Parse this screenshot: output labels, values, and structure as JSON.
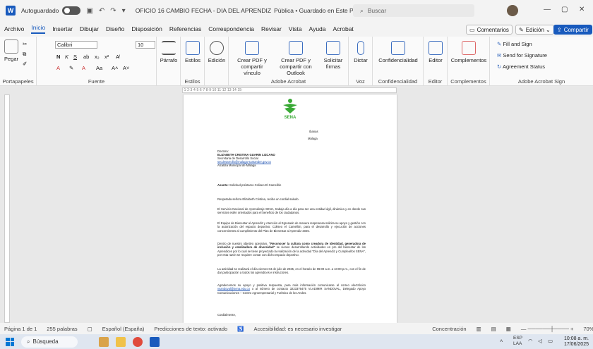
{
  "titlebar": {
    "autosave": "Autoguardado",
    "doc_title": "OFICIO 16 CAMBIO FECHA - DIA DEL APRENDIZ",
    "visibility": "Pública • Guardado en Este PC",
    "search_placeholder": "Buscar"
  },
  "tabs": [
    "Archivo",
    "Inicio",
    "Insertar",
    "Dibujar",
    "Diseño",
    "Disposición",
    "Referencias",
    "Correspondencia",
    "Revisar",
    "Vista",
    "Ayuda",
    "Acrobat"
  ],
  "ribbon_right": {
    "comments": "Comentarios",
    "editing": "Edición",
    "share": "Compartir"
  },
  "ribbon": {
    "paste": "Pegar",
    "clipboard": "Portapapeles",
    "font_name": "Calibri",
    "font_size": "10",
    "font_group": "Fuente",
    "paragraph": "Párrafo",
    "styles": "Estilos",
    "styles_group": "Estilos",
    "editing": "Edición",
    "create_pdf_link": "Crear PDF y compartir vínculo",
    "create_pdf_outlook": "Crear PDF y compartir con Outlook",
    "request_sign": "Solicitar firmas",
    "adobe_acrobat": "Adobe Acrobat",
    "dictate": "Dictar",
    "voice": "Voz",
    "confidentiality": "Confidencialidad",
    "confidentiality_group": "Confidencialidad",
    "editor": "Editor",
    "editor_group": "Editor",
    "addins": "Complementos",
    "addins_group": "Complementos",
    "fill_sign": "Fill and Sign",
    "send_signature": "Send for Signature",
    "agreement_status": "Agreement Status",
    "acrobat_sign": "Adobe Acrobat Sign"
  },
  "document": {
    "logo_text": "SENA",
    "city_header": "Ibanas",
    "place": "Málaga",
    "salutation": "Doctora:",
    "recipient_name": "ELIZABETH CRISTINA GUARIN LIZCANO",
    "recipient_role": "Secretaria de Desarrollo Social",
    "recipient_email": "secdesarrollo@malaga-santander.gov.co",
    "recipient_org": "Alcaldía Municipal de Málaga",
    "subject_label": "Asunto:",
    "subject": "Solicitud préstamo Coliseo El Camellón",
    "greeting": "Respetada señora Elizabeth Cristina, reciba un cordial saludo.",
    "p1": "El Servicio Nacional de Aprendizaje SENA, trabaja día a día para ser una entidad ágil, dinámica y en donde sus servicios estén orientados para el beneficio de los ciudadanos.",
    "p2": "El Equipo de Bienestar al Aprendiz y Atención al Egresado de manera respetuosa solicita su apoyo y gestión con la autorización del espacio deportivo: Coliseo el Camellón, para el desarrollo y ejecución de acciones concernientes al cumplimiento del Plan de Bienestar al Aprendiz 2025.",
    "p3_start": "Dentro de nuestro objetivo operativo,",
    "p3_bold": "\"Reconocer la cultura como creadora de identidad, generadora de inclusión y catalizadora de diversidad\"",
    "p3_end": "se vienen desarrollando actividades en pro del bienestar de los Aprendices por lo cual se tiene proyectado la realización de la actividad \"Día del Aprendiz y Cumpleaños SENA\", por esta razón se requiere contar con dicho espacio deportivo.",
    "p4": "La actividad se realizará el día viernes 04 de julio de 2025, en el horario de 06:00 a.m. a 10:00 p.m., con el fin de dar participación a todos los aprendices e instructores.",
    "p5_start": "Agradecemos su apoyo y positiva respuesta, para más información comunicarse al correo electrónico",
    "p5_email": "vsandoval@sena.edu.co",
    "p5_end": "o al número de contacto 3223376475 VLADIMIR SANDOVAL, Delegado Apoyo Comunicaciones – Centro Agroempresarial y Turístico de los Andes.",
    "closing": "Cordialmente,"
  },
  "statusbar": {
    "page": "Página 1 de 1",
    "words": "255 palabras",
    "language": "Español (España)",
    "predictions": "Predicciones de texto: activado",
    "accessibility": "Accesibilidad: es necesario investigar",
    "focus": "Concentración",
    "zoom": "70%"
  },
  "taskbar": {
    "search": "Búsqueda",
    "lang": "ESP",
    "lang2": "LAA",
    "time": "10:08 a. m.",
    "date": "17/06/2025"
  }
}
